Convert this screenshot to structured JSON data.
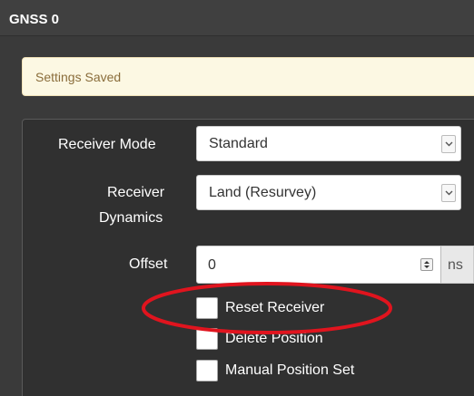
{
  "header": {
    "title": "GNSS 0"
  },
  "alert": {
    "text": "Settings Saved",
    "bg_color": "#fcf8e3",
    "text_color": "#8a6d3b"
  },
  "form": {
    "receiver_mode": {
      "label": "Receiver Mode",
      "value": "Standard",
      "icon": "chevron-down-icon"
    },
    "receiver_dynamics": {
      "label_line1": "Receiver",
      "label_line2": "Dynamics",
      "value": "Land (Resurvey)",
      "icon": "chevron-down-icon"
    },
    "offset": {
      "label": "Offset",
      "value": "0",
      "unit": "ns",
      "icon": "stepper-icon"
    },
    "checkboxes": [
      {
        "label": "Reset Receiver",
        "checked": false,
        "highlighted": true
      },
      {
        "label": "Delete Position",
        "checked": false
      },
      {
        "label": "Manual Position Set",
        "checked": false
      }
    ]
  },
  "colors": {
    "header_bg": "#404040",
    "panel_bg": "#303030",
    "annotation": "#e0141e"
  }
}
